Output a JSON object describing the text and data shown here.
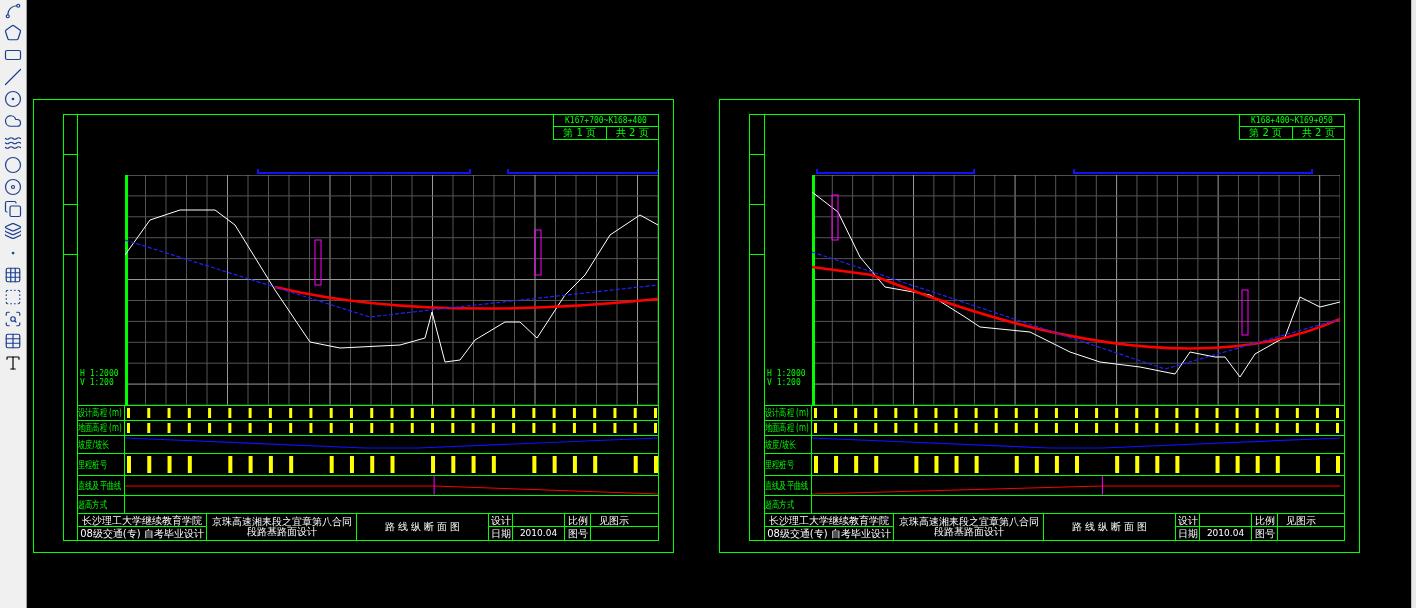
{
  "sheets": [
    {
      "station_range": "K167+700~K168+400",
      "page": "第 1 页",
      "total": "共 2 页",
      "scale": [
        "H 1:2000",
        "V 1:200"
      ],
      "rows": [
        "设计高程 (m)",
        "地面高程 (m)",
        "坡度/坡长",
        "里程桩号",
        "直线及平曲线",
        "超高方式"
      ],
      "title_block": {
        "school": "长沙理工大学继续教育学院",
        "class": "08级交通(专) 自考毕业设计",
        "project": "京珠高速湘耒段之宜章第八合同段路基路面设计",
        "drawing_title": "路 线 纵 断 面 图",
        "design_label": "设计",
        "date_label": "日期",
        "date": "2010.04",
        "scale_label": "比例",
        "number_label": "图号",
        "scale_value": "见图示"
      }
    },
    {
      "station_range": "K168+400~K169+050",
      "page": "第 2 页",
      "total": "共 2 页",
      "scale": [
        "H 1:2000",
        "V 1:200"
      ],
      "rows": [
        "设计高程 (m)",
        "地面高程 (m)",
        "坡度/坡长",
        "里程桩号",
        "直线及平曲线",
        "超高方式"
      ],
      "title_block": {
        "school": "长沙理工大学继续教育学院",
        "class": "08级交通(专) 自考毕业设计",
        "project": "京珠高速湘耒段之宜章第八合同段路基路面设计",
        "drawing_title": "路 线 纵 断 面 图",
        "design_label": "设计",
        "date_label": "日期",
        "date": "2010.04",
        "scale_label": "比例",
        "number_label": "图号",
        "scale_value": "见图示"
      }
    }
  ]
}
